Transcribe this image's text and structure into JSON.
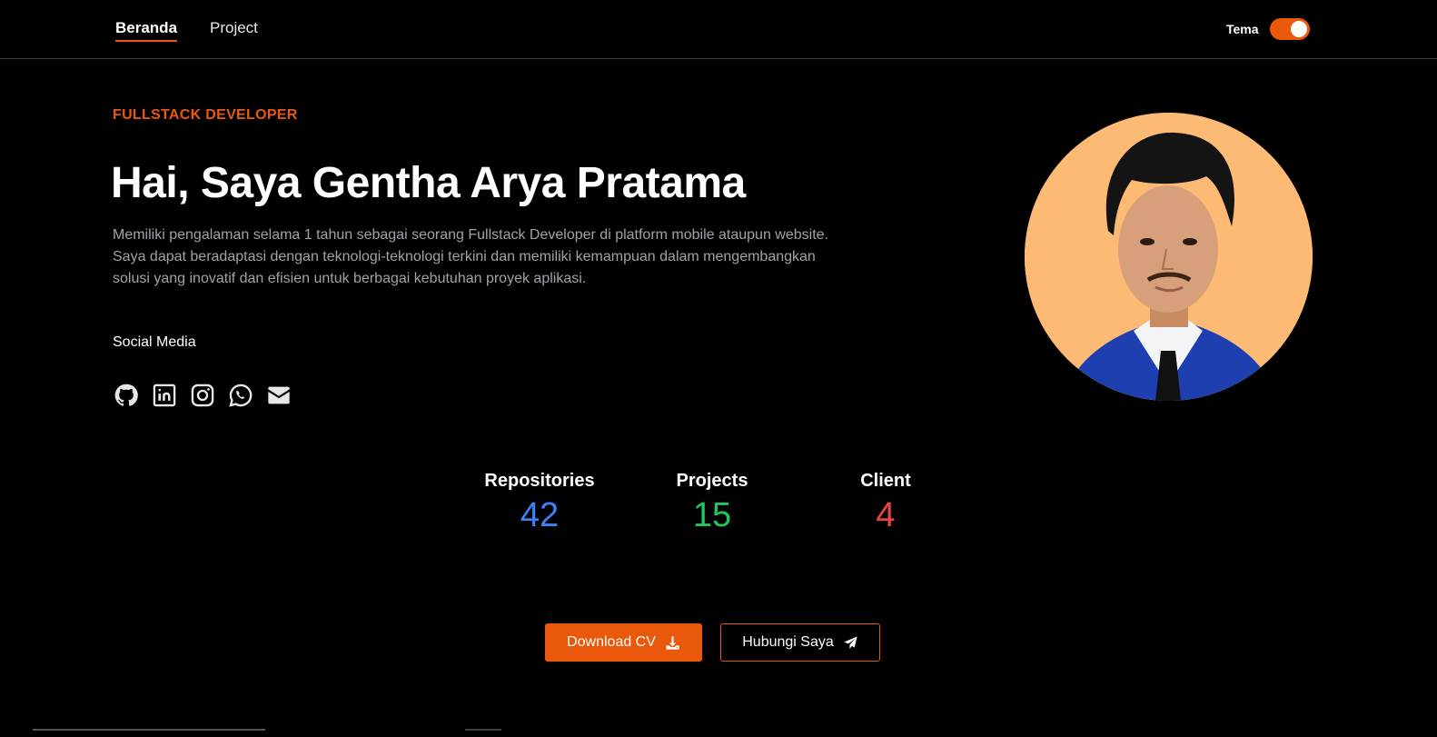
{
  "nav": {
    "links": [
      {
        "label": "Beranda",
        "active": true
      },
      {
        "label": "Project",
        "active": false
      }
    ],
    "theme_label": "Tema",
    "theme_toggle_on": true
  },
  "hero": {
    "eyebrow": "FULLSTACK DEVELOPER",
    "title": "Hai, Saya Gentha Arya Pratama",
    "description": "Memiliki pengalaman selama 1 tahun sebagai seorang Fullstack Developer di platform mobile ataupun website. Saya dapat beradaptasi dengan teknologi-teknologi terkini dan memiliki kemampuan dalam mengembangkan solusi yang inovatif dan efisien untuk berbagai kebutuhan proyek aplikasi.",
    "social_label": "Social Media",
    "socials": [
      "github-icon",
      "linkedin-icon",
      "instagram-icon",
      "whatsapp-icon",
      "email-icon"
    ]
  },
  "stats": [
    {
      "label": "Repositories",
      "value": "42",
      "color": "#3b82f6"
    },
    {
      "label": "Projects",
      "value": "15",
      "color": "#22c55e"
    },
    {
      "label": "Client",
      "value": "4",
      "color": "#ef4444"
    }
  ],
  "actions": {
    "download_label": "Download CV",
    "contact_label": "Hubungi Saya"
  },
  "colors": {
    "accent": "#ea580c",
    "background": "#000000",
    "muted_text": "#a1a1aa",
    "avatar_bg": "#fdba74"
  }
}
